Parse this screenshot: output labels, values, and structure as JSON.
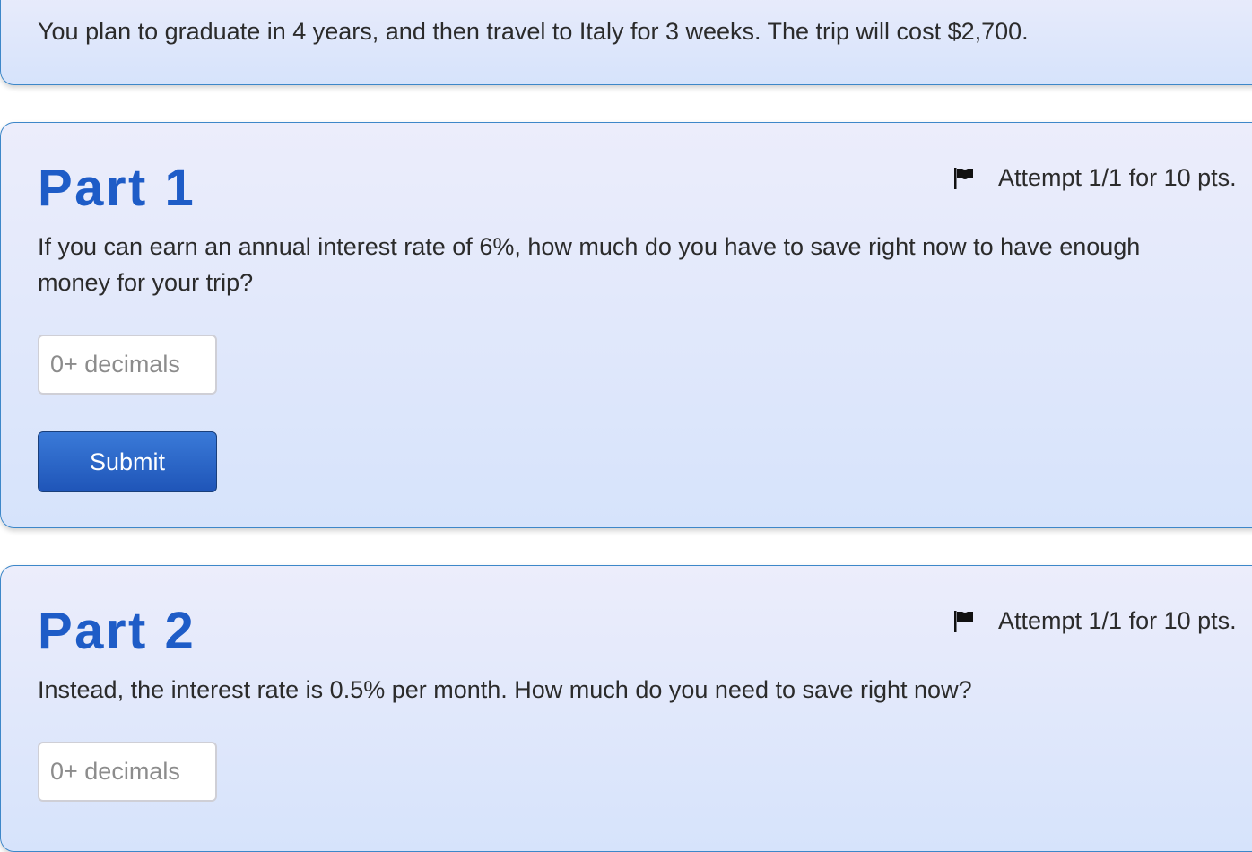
{
  "intro": {
    "text": "You plan to graduate in 4 years, and then travel to Italy for 3 weeks. The trip will cost $2,700."
  },
  "parts": [
    {
      "title": "Part 1",
      "attempt": "Attempt 1/1 for 10 pts.",
      "flag_icon": "flag-icon",
      "question": "If you can earn an annual interest rate of 6%, how much do you have to save right now to have enough money for your trip?",
      "input_placeholder": "0+ decimals",
      "input_value": "",
      "submit_label": "Submit"
    },
    {
      "title": "Part 2",
      "attempt": "Attempt 1/1 for 10 pts.",
      "flag_icon": "flag-icon",
      "question": "Instead, the interest rate is 0.5% per month. How much do you need to save right now?",
      "input_placeholder": "0+ decimals",
      "input_value": ""
    }
  ],
  "colors": {
    "title": "#1e5cc7",
    "card_border": "#3d87c9",
    "button": "#1f55b8"
  }
}
